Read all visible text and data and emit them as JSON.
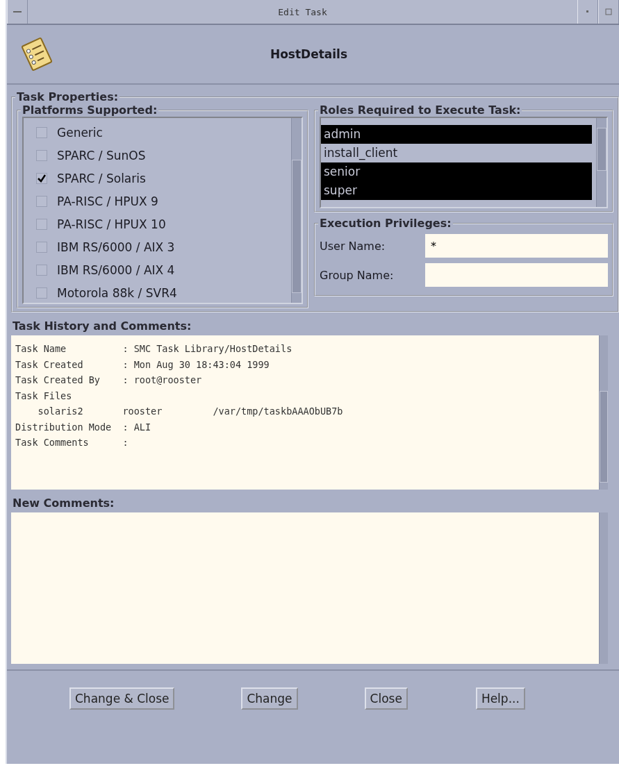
{
  "window": {
    "title": "Edit Task"
  },
  "header": {
    "title": "HostDetails"
  },
  "task_properties": {
    "title": "Task Properties:",
    "platforms": {
      "title": "Platforms Supported:",
      "items": [
        {
          "label": "Generic",
          "checked": false
        },
        {
          "label": "SPARC / SunOS",
          "checked": false
        },
        {
          "label": "SPARC / Solaris",
          "checked": true
        },
        {
          "label": "PA-RISC / HPUX 9",
          "checked": false
        },
        {
          "label": "PA-RISC / HPUX 10",
          "checked": false
        },
        {
          "label": "IBM RS/6000 / AIX 3",
          "checked": false
        },
        {
          "label": "IBM RS/6000 / AIX 4",
          "checked": false
        },
        {
          "label": "Motorola 88k / SVR4",
          "checked": false
        }
      ]
    },
    "roles": {
      "title": "Roles Required to Execute Task:",
      "items": [
        {
          "label": "admin",
          "selected": true
        },
        {
          "label": "install_client",
          "selected": false
        },
        {
          "label": "senior",
          "selected": true
        },
        {
          "label": "super",
          "selected": true
        }
      ]
    },
    "privileges": {
      "title": "Execution Privileges:",
      "fields": [
        {
          "label": "User Name:",
          "value": "*"
        },
        {
          "label": "Group Name:"
        }
      ]
    }
  },
  "history": {
    "title": "Task History and Comments:",
    "lines": [
      "Task Name          : SMC Task Library/HostDetails",
      "Task Created       : Mon Aug 30 18:43:04 1999",
      "Task Created By    : root@rooster",
      "Task Files",
      "    solaris2       rooster         /var/tmp/taskbAAAObUB7b",
      "Distribution Mode  : ALI",
      "Task Comments      :"
    ]
  },
  "new_comments": {
    "title": "New Comments:"
  },
  "buttons": [
    "Change & Close",
    "Change",
    "Close",
    "Help..."
  ]
}
